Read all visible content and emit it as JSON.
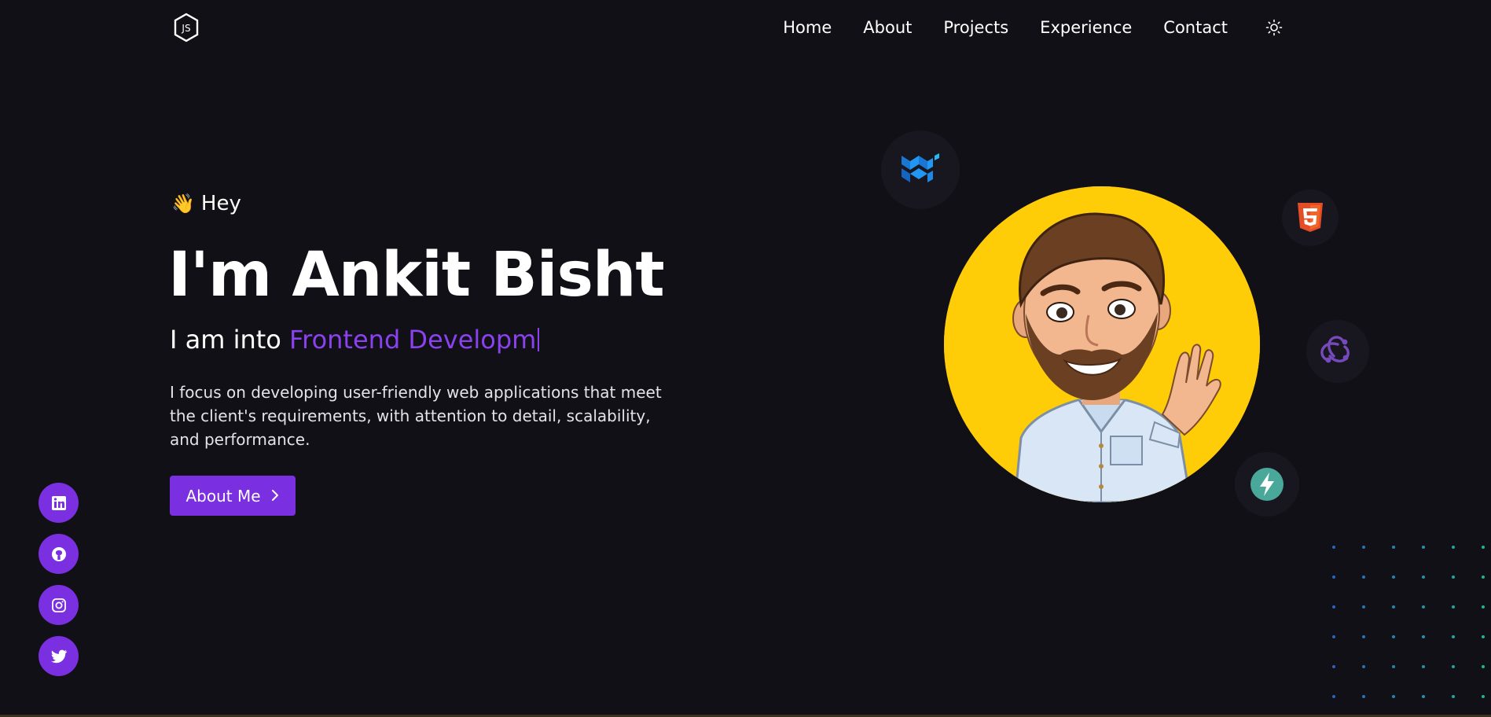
{
  "header": {
    "logo_icon": "nodejs-js-hexagon-icon",
    "nav": [
      "Home",
      "About",
      "Projects",
      "Experience",
      "Contact"
    ],
    "theme_toggle_icon": "sun-icon"
  },
  "hero": {
    "greeting_icon": "waving-hand-icon",
    "greeting": "Hey",
    "headline": "I'm Ankit Bisht",
    "role_prefix": "I am into",
    "role_typed": "Frontend Developm",
    "description": "I focus on developing user-friendly web applications that meet the client's requirements, with attention to detail, scalability, and performance.",
    "cta_label": "About Me",
    "cta_icon": "chevron-right-icon"
  },
  "socials": [
    {
      "icon": "linkedin-icon"
    },
    {
      "icon": "github-icon"
    },
    {
      "icon": "instagram-icon"
    },
    {
      "icon": "twitter-icon"
    }
  ],
  "tech_icons": [
    "material-ui-icon",
    "html5-icon",
    "redux-icon",
    "fastapi-icon"
  ],
  "avatar": {
    "icon": "bitmoji-avatar"
  },
  "colors": {
    "background": "#121017",
    "accent": "#7a2fe0",
    "accent_text": "#8a42f0",
    "avatar_bg": "#ffcc08"
  }
}
